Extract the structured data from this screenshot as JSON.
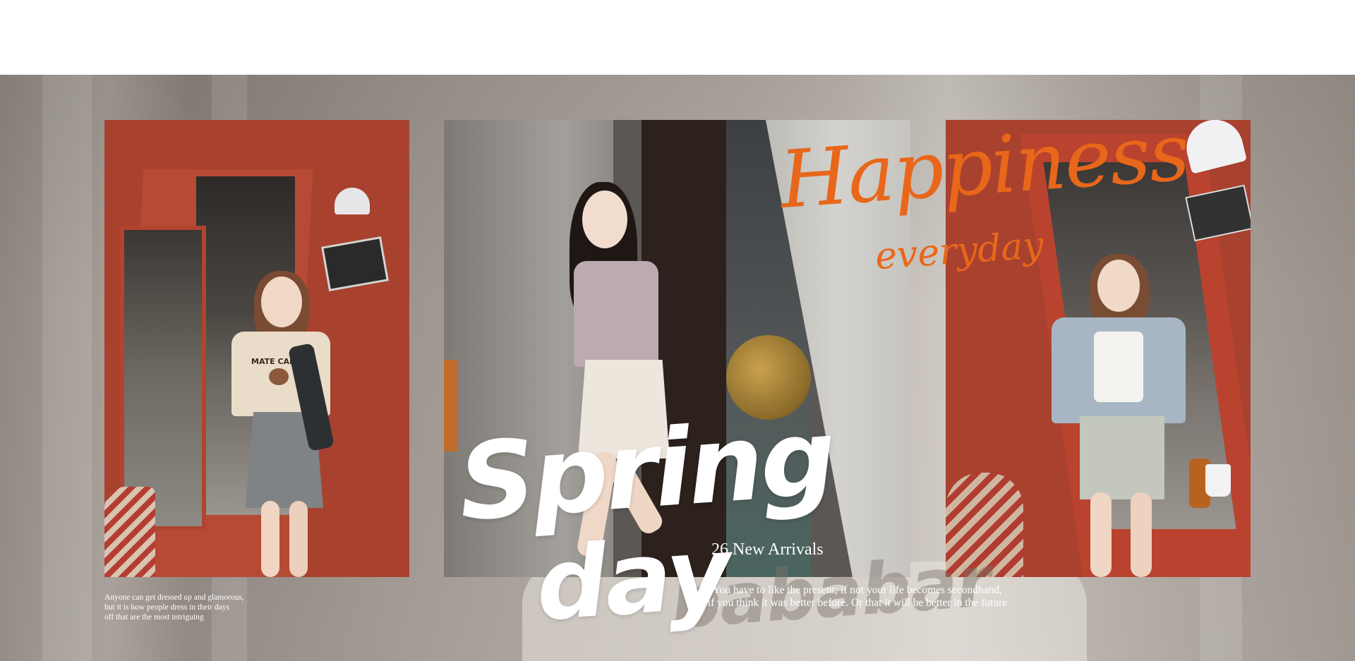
{
  "banner": {
    "script_title": "Happiness",
    "script_subtitle": "everyday",
    "headline_line1": "Spring",
    "headline_line2": "day",
    "brand_watermark": "bababar",
    "arrivals": "26 New Arrivals",
    "quote": [
      "You have to like the present; if not your life becomes secondhand,",
      "if you think it was better before. Or that it will be better in the future"
    ],
    "left_caption": [
      "Anyone can get dressed up and glamorous,",
      "but it is how people dress in their days",
      "off that are the most intriguing"
    ],
    "shirt_print": "MATE CAFE"
  },
  "colors": {
    "accent_script": "#e8671a",
    "headline": "#ffffff",
    "door_red": "#a8422f",
    "background": "#a59d96"
  }
}
